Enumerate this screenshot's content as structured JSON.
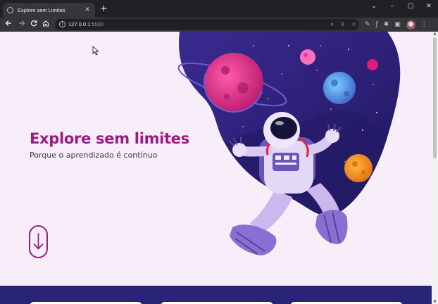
{
  "browser": {
    "tab_title": "Explore sem Limites",
    "url_host": "127.0.0.1",
    "url_port": ":5500",
    "window_controls": {
      "minimize": "–",
      "maximize": "□",
      "close": "✕",
      "tab_menu": "⌄"
    },
    "new_tab": "+",
    "tab_close": "✕"
  },
  "hero": {
    "title": "Explore sem limites",
    "subtitle": "Porque o aprendizado é contínuo",
    "accent_color": "#9b1a86"
  },
  "icons": {
    "back": "arrow-left-icon",
    "forward": "arrow-right-icon",
    "reload": "reload-icon",
    "home": "home-icon",
    "scroll_down": "arrow-down-icon",
    "illustration": "astronaut-illustration"
  }
}
